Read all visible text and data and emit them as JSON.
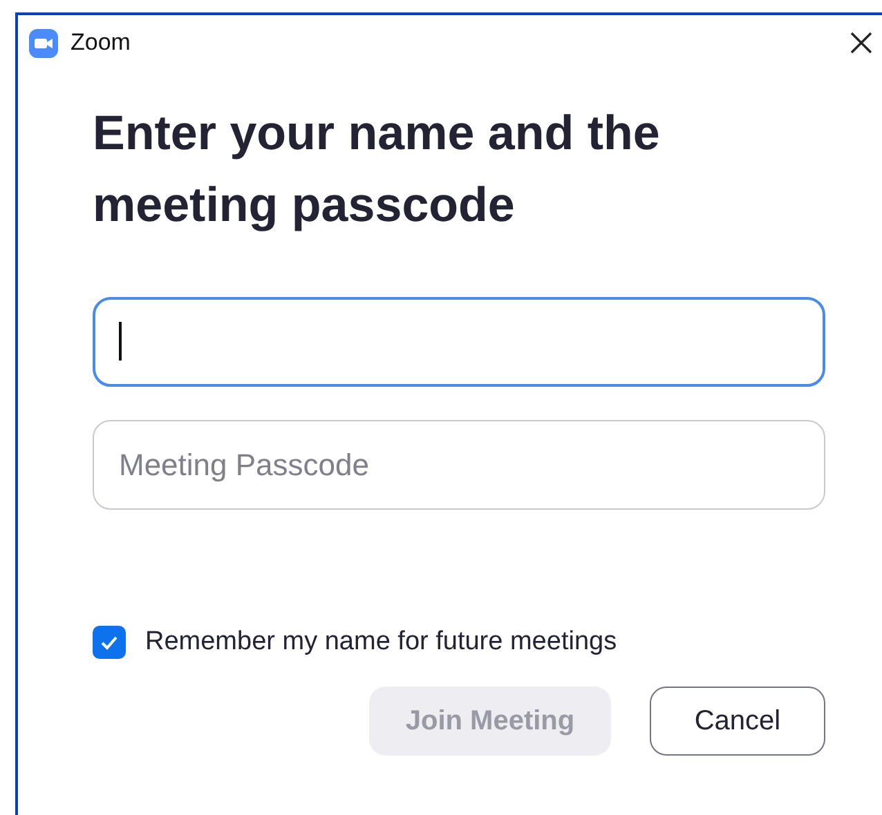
{
  "window": {
    "title": "Zoom"
  },
  "heading": "Enter your name and the meeting passcode",
  "fields": [
    {
      "focused": true
    },
    {
      "placeholder": "Meeting Passcode",
      "focused": false
    }
  ],
  "remember": {
    "label": "Remember my name for future meetings",
    "checked": true
  },
  "buttons": [
    {
      "label": "Join Meeting",
      "disabled": true
    },
    {
      "label": "Cancel",
      "disabled": false
    }
  ]
}
